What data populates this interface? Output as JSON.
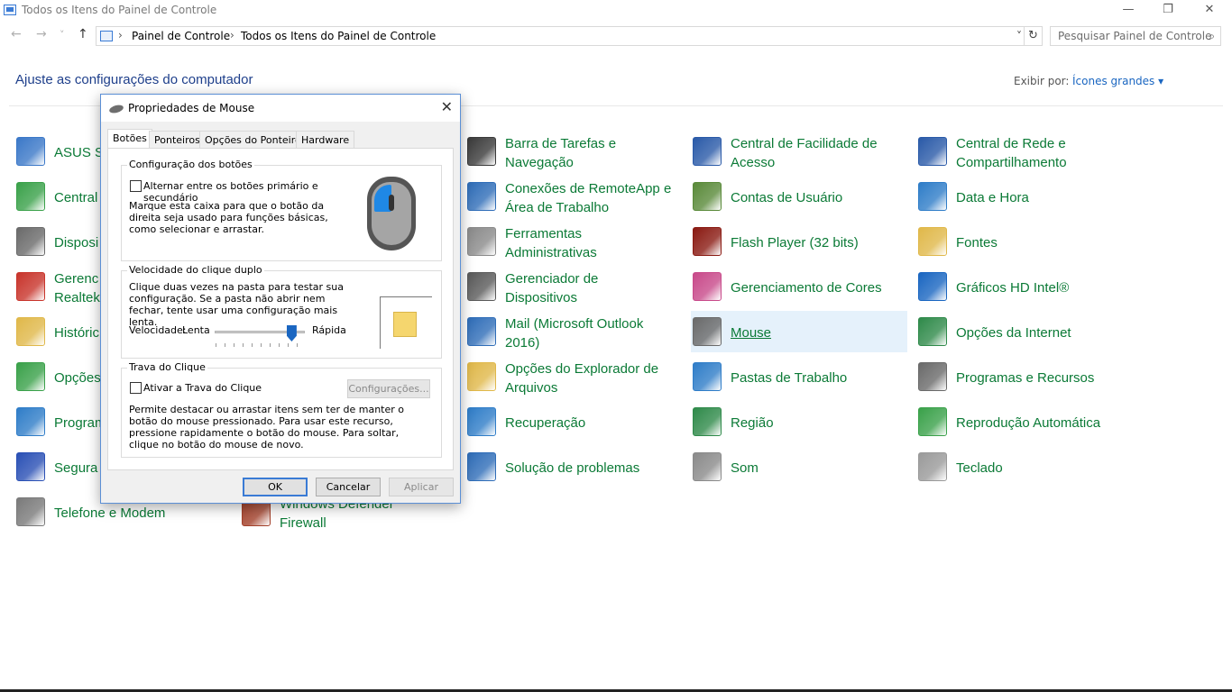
{
  "window": {
    "title": "Todos os Itens do Painel de Controle",
    "controls": {
      "minimize": "—",
      "restore": "❐",
      "close": "✕"
    }
  },
  "address": {
    "back": "←",
    "forward": "→",
    "recent": "˅",
    "up": "↑",
    "crumbs": [
      "Painel de Controle",
      "Todos os Itens do Painel de Controle"
    ],
    "separator": "›",
    "dropdown": "˅",
    "refresh": "↻"
  },
  "search": {
    "placeholder": "Pesquisar Painel de Controle",
    "icon": "⌕"
  },
  "header": {
    "title": "Ajuste as configurações do computador",
    "view_by_label": "Exibir por:",
    "view_by_value": "Ícones grandes ▾"
  },
  "items": [
    {
      "label": "ASUS S",
      "icon_color": "#3b78c8"
    },
    {
      "label": "Central",
      "icon_color": "#3aa14a"
    },
    {
      "label": "Disposi",
      "icon_color": "#6a6a6a"
    },
    {
      "label": "Gerenc\nRealtek",
      "icon_color": "#c8342b"
    },
    {
      "label": "Históric",
      "icon_color": "#e0b84a"
    },
    {
      "label": "Opções",
      "icon_color": "#3aa14a"
    },
    {
      "label": "Program",
      "icon_color": "#2f7dc8"
    },
    {
      "label": "Segura",
      "icon_color": "#2a50b5"
    },
    {
      "label": "Telefone e Modem",
      "icon_color": "#7a7a7a"
    },
    {
      "label": "Windows Defender\nFirewall",
      "icon_color": "#a3402a"
    },
    {
      "label": "Barra de Tarefas e\nNavegação",
      "icon_color": "#3a3a3a"
    },
    {
      "label": "Conexões de RemoteApp e\nÁrea de Trabalho",
      "icon_color": "#2f6db8"
    },
    {
      "label": "Ferramentas\nAdministrativas",
      "icon_color": "#8a8a8a"
    },
    {
      "label": "Gerenciador de\nDispositivos",
      "icon_color": "#5a5a5a"
    },
    {
      "label": "Mail (Microsoft Outlook\n2016)",
      "icon_color": "#2f6db8"
    },
    {
      "label": "Opções do Explorador de\nArquivos",
      "icon_color": "#e0b84a"
    },
    {
      "label": "Recuperação",
      "icon_color": "#2f7dc8"
    },
    {
      "label": "Solução de problemas",
      "icon_color": "#2f6db8"
    },
    {
      "label": "Central de Facilidade de\nAcesso",
      "icon_color": "#2a5aa8"
    },
    {
      "label": "Contas de Usuário",
      "icon_color": "#5a8a3a"
    },
    {
      "label": "Flash Player (32 bits)",
      "icon_color": "#8a1a12"
    },
    {
      "label": "Gerenciamento de Cores",
      "icon_color": "#c84a8a"
    },
    {
      "label": "Mouse",
      "icon_color": "#6a6a6a"
    },
    {
      "label": "Pastas de Trabalho",
      "icon_color": "#2f7dc8"
    },
    {
      "label": "Região",
      "icon_color": "#2f8a4a"
    },
    {
      "label": "Som",
      "icon_color": "#8a8a8a"
    },
    {
      "label": "Central de Rede e\nCompartilhamento",
      "icon_color": "#2a5aa8"
    },
    {
      "label": "Data e Hora",
      "icon_color": "#2f7dc8"
    },
    {
      "label": "Fontes",
      "icon_color": "#e0b84a"
    },
    {
      "label": "Gráficos HD Intel®",
      "icon_color": "#1a66c1"
    },
    {
      "label": "Opções da Internet",
      "icon_color": "#2f8a4a"
    },
    {
      "label": "Programas e Recursos",
      "icon_color": "#6a6a6a"
    },
    {
      "label": "Reprodução Automática",
      "icon_color": "#3aa14a"
    },
    {
      "label": "Teclado",
      "icon_color": "#9a9a9a"
    }
  ],
  "dialog": {
    "title": "Propriedades de Mouse",
    "close": "✕",
    "tabs": [
      "Botões",
      "Ponteiros",
      "Opções do Ponteiro",
      "Hardware"
    ],
    "buttons_group": {
      "title": "Configuração dos botões",
      "checkbox_label": "Alternar entre os botões primário e secundário",
      "description": "Marque esta caixa para que o botão da direita seja usado para funções básicas, como selecionar e arrastar."
    },
    "doubleclick_group": {
      "title": "Velocidade do clique duplo",
      "description": "Clique duas vezes na pasta para testar sua configuração. Se a pasta não abrir nem fechar, tente usar uma configuração mais lenta.",
      "speed_label": "Velocidade:",
      "slow_label": "Lenta",
      "fast_label": "Rápida",
      "speed_value": 0.85
    },
    "clicklock_group": {
      "title": "Trava do Clique",
      "checkbox_label": "Ativar a Trava do Clique",
      "settings_button": "Configurações...",
      "description": "Permite destacar ou arrastar itens sem ter de manter o botão do mouse pressionado. Para usar este recurso, pressione rapidamente o botão do mouse. Para soltar, clique no botão do mouse de novo."
    },
    "footer": {
      "ok": "OK",
      "cancel": "Cancelar",
      "apply": "Aplicar"
    }
  }
}
